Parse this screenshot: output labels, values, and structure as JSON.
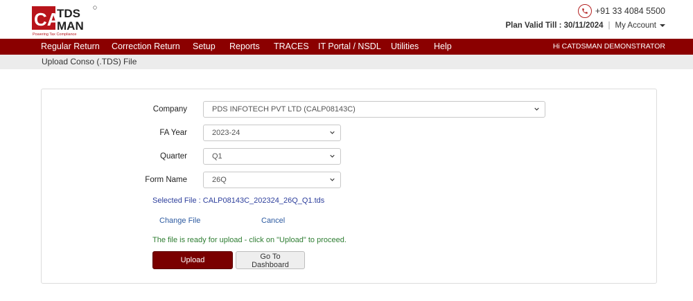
{
  "header": {
    "logo_text": "TDSMAN",
    "logo_tagline": "Powering Tax Compliance",
    "phone": "+91 33 4084 5500",
    "plan_label": "Plan Valid Till : 30/11/2024",
    "separator": "|",
    "account_label": "My Account"
  },
  "nav": {
    "items": [
      "Regular Return",
      "Correction Return",
      "Setup",
      "Reports",
      "TRACES",
      "IT Portal / NSDL",
      "Utilities",
      "Help"
    ],
    "greeting": "Hi CATDSMAN DEMONSTRATOR"
  },
  "breadcrumb": "Upload Conso (.TDS) File",
  "form": {
    "company_label": "Company",
    "company_value": "PDS INFOTECH PVT LTD (CALP08143C)",
    "fa_year_label": "FA Year",
    "fa_year_value": "2023-24",
    "quarter_label": "Quarter",
    "quarter_value": "Q1",
    "form_name_label": "Form Name",
    "form_name_value": "26Q",
    "selected_file": "Selected File : CALP08143C_202324_26Q_Q1.tds",
    "change_file": "Change File",
    "cancel": "Cancel",
    "ready_message": "The file is ready for upload - click on \"Upload\" to proceed.",
    "upload_button": "Upload",
    "dashboard_button": "Go To Dashboard"
  },
  "colors": {
    "brand": "#8b0000",
    "upload_button": "#7a0000",
    "success_text": "#2e7d32",
    "link": "#2c5aa0"
  }
}
